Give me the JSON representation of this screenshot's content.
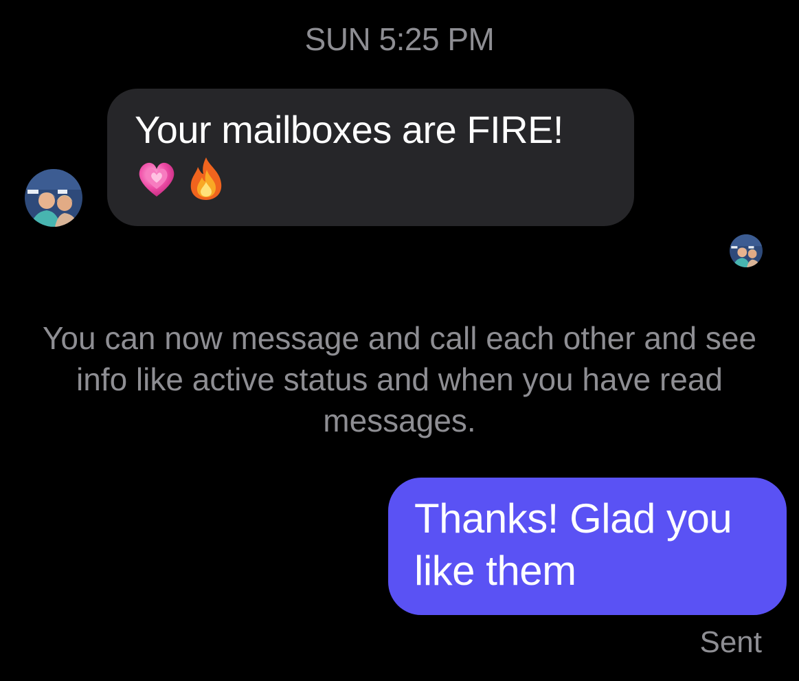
{
  "conversation": {
    "timestamp": "SUN 5:25 PM",
    "incoming_message": {
      "text": "Your mailboxes are FIRE!",
      "emoji": [
        "growing-heart",
        "fire"
      ]
    },
    "system_notice": "You can now message and call each other and see info like active status and when you have read messages.",
    "outgoing_message": {
      "text": "Thanks! Glad you like them"
    },
    "status": "Sent"
  },
  "colors": {
    "background": "#000000",
    "incoming_bubble": "#262629",
    "outgoing_bubble": "#5a52f4",
    "secondary_text": "#8e8e93"
  }
}
